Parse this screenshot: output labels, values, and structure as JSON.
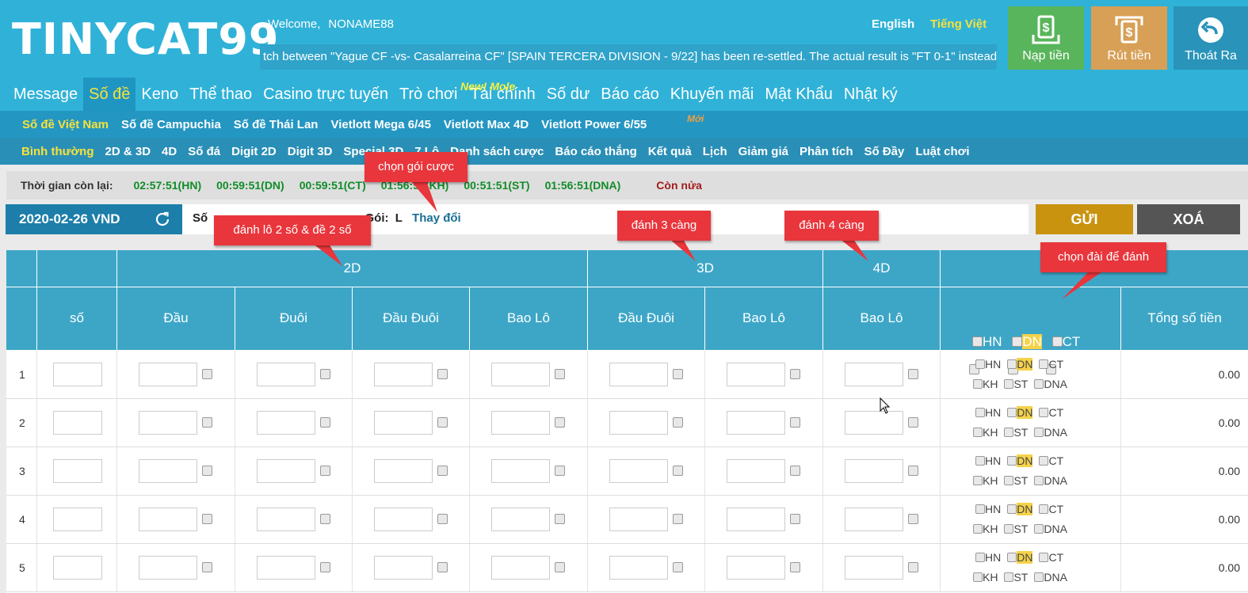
{
  "header": {
    "logo": "TINYCAT99",
    "welcome_label": "Welcome,",
    "username": "NONAME88",
    "lang_en": "English",
    "lang_vi": "Tiếng Việt",
    "marquee": "tch between \"Yague CF -vs- Casalarreina CF\" [SPAIN TERCERA DIVISION - 9/22] has been re-settled. The actual result is \"FT 0-1\" instead",
    "buttons": {
      "deposit": "Nạp tiền",
      "withdraw": "Rút tiền",
      "logout": "Thoát Ra"
    },
    "colors": {
      "bar": "#30b2d8",
      "deposit": "#59b55b",
      "withdraw": "#d7a056",
      "logout": "#2993b9"
    }
  },
  "main_nav": {
    "items": [
      "Message",
      "Số đề",
      "Keno",
      "Thể thao",
      "Casino trực tuyến",
      "Trò chơi",
      "Tài chính",
      "Số dư",
      "Báo cáo",
      "Khuyến mãi",
      "Mật Khẩu",
      "Nhật ký"
    ],
    "active": "Số đề",
    "new_badge": "New! Mole"
  },
  "sub_nav": {
    "items": [
      "Số đề Việt Nam",
      "Số đề Campuchia",
      "Số đề Thái Lan",
      "Vietlott Mega 6/45",
      "Vietlott Max 4D",
      "Vietlott Power 6/55"
    ],
    "active": "Số đề Việt Nam",
    "new_badge": "Mới"
  },
  "bet_nav": {
    "items": [
      "Bình thường",
      "2D & 3D",
      "4D",
      "Số đá",
      "Digit 2D",
      "Digit 3D",
      "Special 3D",
      "7 Lô",
      "Danh sách cược",
      "Báo cáo thắng",
      "Kết quả",
      "Lịch",
      "Giảm giá",
      "Phân tích",
      "Số Đầy",
      "Luật chơi"
    ],
    "active": "Bình thường"
  },
  "time_bar": {
    "label": "Thời gian còn lại:",
    "times": [
      "02:57:51(HN)",
      "00:59:51(DN)",
      "00:59:51(CT)",
      "01:56:51(KH)",
      "00:51:51(ST)",
      "01:56:51(DNA)"
    ],
    "more": "Còn nửa"
  },
  "date_bar": {
    "date": "2020-02-26 VND",
    "info_so": "Số",
    "info_goi_label": "Gói:",
    "info_goi_value": "L",
    "change": "Thay đổi",
    "send": "GỬI",
    "clear": "XOÁ"
  },
  "table": {
    "groups": [
      "2D",
      "3D",
      "4D"
    ],
    "columns": [
      "số",
      "Đầu",
      "Đuôi",
      "Đầu Đuôi",
      "Bao Lô",
      "Đầu Đuôi",
      "Bao Lô",
      "Bao Lô",
      "Tổng số tiền"
    ],
    "stations": [
      "HN",
      "DN",
      "CT",
      "KH",
      "ST",
      "DNA"
    ],
    "rows": [
      {
        "num": "1",
        "total": "0.00"
      },
      {
        "num": "2",
        "total": "0.00"
      },
      {
        "num": "3",
        "total": "0.00"
      },
      {
        "num": "4",
        "total": "0.00"
      },
      {
        "num": "5",
        "total": "0.00"
      }
    ]
  },
  "callouts": {
    "package": "chọn gói cược",
    "two_d": "đánh lô 2 số & đề 2 số",
    "three_d": "đánh 3 càng",
    "four_d": "đánh 4 càng",
    "station": "chọn đài để đánh",
    "color": "#e8363c"
  }
}
